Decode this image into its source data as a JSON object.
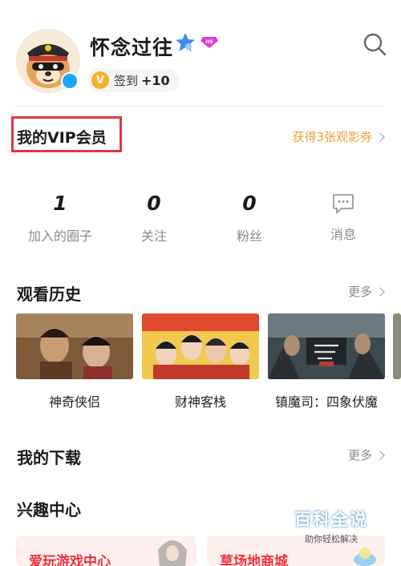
{
  "profile": {
    "username": "怀念过往",
    "level_badge": "H5",
    "signin_label": "签到",
    "signin_points": "+10",
    "vip_letter": "V"
  },
  "vip": {
    "title": "我的VIP会员",
    "promo": "获得3张观影券"
  },
  "stats": [
    {
      "value": "1",
      "label": "加入的圈子"
    },
    {
      "value": "0",
      "label": "关注"
    },
    {
      "value": "0",
      "label": "粉丝"
    },
    {
      "value": "",
      "label": "消息"
    }
  ],
  "history": {
    "title": "观看历史",
    "more": "更多",
    "items": [
      {
        "title": "神奇侠侣"
      },
      {
        "title": "财神客栈"
      },
      {
        "title": "镇魔司：四象伏魔"
      }
    ]
  },
  "downloads": {
    "title": "我的下载",
    "more": "更多"
  },
  "interest": {
    "title": "兴趣中心",
    "cards": [
      {
        "label": "爱玩游戏中心"
      },
      {
        "label": "草场地商城"
      }
    ]
  },
  "watermark": {
    "main": "百科全说",
    "sub": "助你轻松解决"
  },
  "colors": {
    "accent_red": "#e8333f",
    "promo_orange": "#e8a13a",
    "vip_gold": "#f3b12b",
    "star_blue": "#3f8cf0",
    "badge_pink": "#e23ad8"
  }
}
